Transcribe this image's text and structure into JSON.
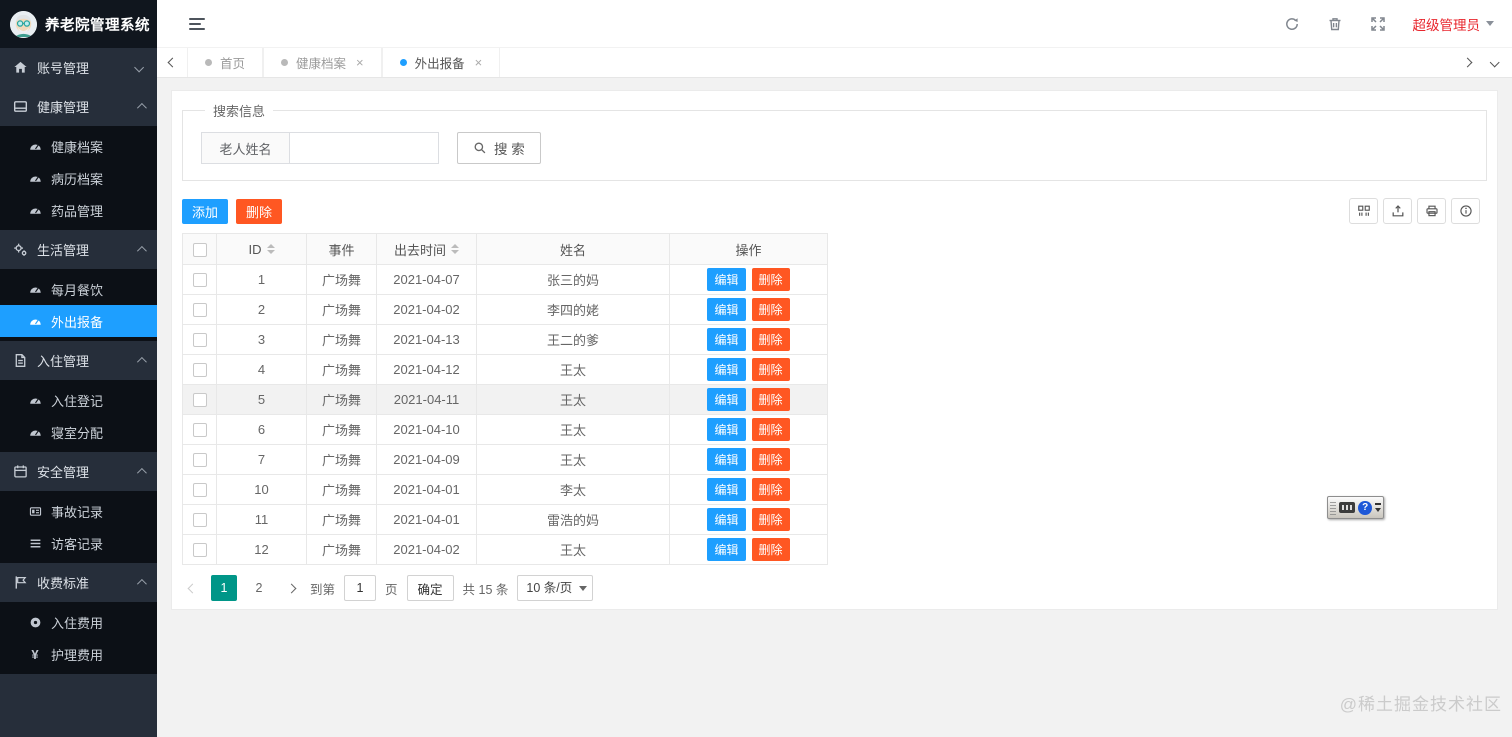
{
  "app": {
    "title": "养老院管理系统",
    "user": "超级管理员"
  },
  "sidebar": {
    "menu": [
      {
        "label": "账号管理",
        "children": []
      },
      {
        "label": "健康管理",
        "children": [
          "健康档案",
          "病历档案",
          "药品管理"
        ]
      },
      {
        "label": "生活管理",
        "children": [
          "每月餐饮",
          "外出报备"
        ]
      },
      {
        "label": "入住管理",
        "children": [
          "入住登记",
          "寝室分配"
        ]
      },
      {
        "label": "安全管理",
        "children": [
          "事故记录",
          "访客记录"
        ]
      },
      {
        "label": "收费标准",
        "children": [
          "入住费用",
          "护理费用"
        ]
      }
    ],
    "active_item": "外出报备"
  },
  "tabs": [
    {
      "label": "首页"
    },
    {
      "label": "健康档案"
    },
    {
      "label": "外出报备"
    }
  ],
  "tab_close_glyph": "×",
  "search": {
    "legend": "搜索信息",
    "field_label": "老人姓名",
    "input_value": "",
    "button_label": "搜 索"
  },
  "toolbar": {
    "add_label": "添加",
    "delete_label": "删除"
  },
  "table": {
    "columns": [
      "ID",
      "事件",
      "出去时间",
      "姓名",
      "操作"
    ],
    "edit_label": "编辑",
    "delete_label": "删除",
    "rows": [
      {
        "id": "1",
        "event": "广场舞",
        "date": "2021-04-07",
        "name": "张三的妈"
      },
      {
        "id": "2",
        "event": "广场舞",
        "date": "2021-04-02",
        "name": "李四的姥"
      },
      {
        "id": "3",
        "event": "广场舞",
        "date": "2021-04-13",
        "name": "王二的爹"
      },
      {
        "id": "4",
        "event": "广场舞",
        "date": "2021-04-12",
        "name": "王太"
      },
      {
        "id": "5",
        "event": "广场舞",
        "date": "2021-04-11",
        "name": "王太"
      },
      {
        "id": "6",
        "event": "广场舞",
        "date": "2021-04-10",
        "name": "王太"
      },
      {
        "id": "7",
        "event": "广场舞",
        "date": "2021-04-09",
        "name": "王太"
      },
      {
        "id": "10",
        "event": "广场舞",
        "date": "2021-04-01",
        "name": "李太"
      },
      {
        "id": "11",
        "event": "广场舞",
        "date": "2021-04-01",
        "name": "雷浩的妈"
      },
      {
        "id": "12",
        "event": "广场舞",
        "date": "2021-04-02",
        "name": "王太"
      }
    ]
  },
  "pagination": {
    "pages": [
      "1",
      "2"
    ],
    "active_page": "1",
    "goto_prefix": "到第",
    "goto_value": "1",
    "goto_suffix": "页",
    "confirm_label": "确定",
    "total_label": "共 15 条",
    "page_size": "10 条/页"
  },
  "ime_help_glyph": "?",
  "watermark": "@稀土掘金技术社区",
  "icons": [
    "home-icon",
    "window-icon",
    "gauge-icon",
    "gears-icon",
    "file-icon",
    "calendar-icon",
    "id-card-icon",
    "list-icon",
    "flag-icon",
    "coin-icon",
    "yen-icon",
    "menu-toggle-icon",
    "refresh-icon",
    "trash-icon",
    "fullscreen-icon",
    "caret-down-icon",
    "search-icon",
    "columns-icon",
    "export-icon",
    "print-icon",
    "info-icon",
    "sort-icon",
    "keyboard-icon",
    "help-icon"
  ],
  "colors": {
    "accent_blue": "#1e9fff",
    "danger_orange": "#ff5722",
    "pager_active_green": "#009688",
    "user_name_red": "#e8262d",
    "sidebar_dark": "#262e3a"
  }
}
